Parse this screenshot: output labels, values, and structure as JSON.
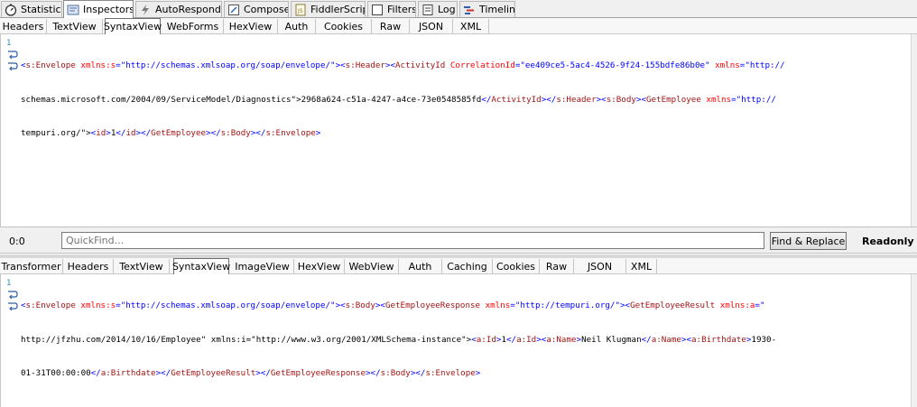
{
  "top_tabs": [
    {
      "label": "Statistics",
      "icon": "stopwatch-icon"
    },
    {
      "label": "Inspectors",
      "icon": "inspectors-icon",
      "active": true
    },
    {
      "label": "AutoResponder",
      "icon": "lightning-icon"
    },
    {
      "label": "Composer",
      "icon": "composer-icon"
    },
    {
      "label": "FiddlerScript",
      "icon": "script-icon"
    },
    {
      "label": "Filters",
      "icon": "checkbox-icon"
    },
    {
      "label": "Log",
      "icon": "log-icon"
    },
    {
      "label": "Timeline",
      "icon": "timeline-icon"
    }
  ],
  "request_tabs": [
    "Headers",
    "TextView",
    "SyntaxView",
    "WebForms",
    "HexView",
    "Auth",
    "Cookies",
    "Raw",
    "JSON",
    "XML"
  ],
  "request_active": "SyntaxView",
  "request_lines": [
    "<s:Envelope xmlns:s=\"http://schemas.xmlsoap.org/soap/envelope/\"><s:Header><ActivityId CorrelationId=\"ee409ce5-5ac4-4526-9f24-155bdfe86b0e\" xmlns=\"http://",
    "schemas.microsoft.com/2004/09/ServiceModel/Diagnostics\">2968a624-c51a-4247-a4ce-73e0548585fd</ActivityId></s:Header><s:Body><GetEmployee xmlns=\"http://",
    "tempuri.org/\"><id>1</id></GetEmployee></s:Body></s:Envelope>"
  ],
  "gutter_number": "1",
  "findbar": {
    "line_col": "0:0",
    "placeholder": "QuickFind...",
    "button": "Find & Replace",
    "status": "Readonly"
  },
  "response_tabs": [
    "Transformer",
    "Headers",
    "TextView",
    "SyntaxView",
    "ImageView",
    "HexView",
    "WebView",
    "Auth",
    "Caching",
    "Cookies",
    "Raw",
    "JSON",
    "XML"
  ],
  "response_active": "SyntaxView",
  "response_lines": [
    "<s:Envelope xmlns:s=\"http://schemas.xmlsoap.org/soap/envelope/\"><s:Body><GetEmployeeResponse xmlns=\"http://tempuri.org/\"><GetEmployeeResult xmlns:a=\"",
    "http://jfzhu.com/2014/10/16/Employee\" xmlns:i=\"http://www.w3.org/2001/XMLSchema-instance\"><a:Id>1</a:Id><a:Name>Neil Klugman</a:Name><a:Birthdate>1930-",
    "01-31T00:00:00</a:Birthdate></GetEmployeeResult></GetEmployeeResponse></s:Body></s:Envelope>"
  ]
}
